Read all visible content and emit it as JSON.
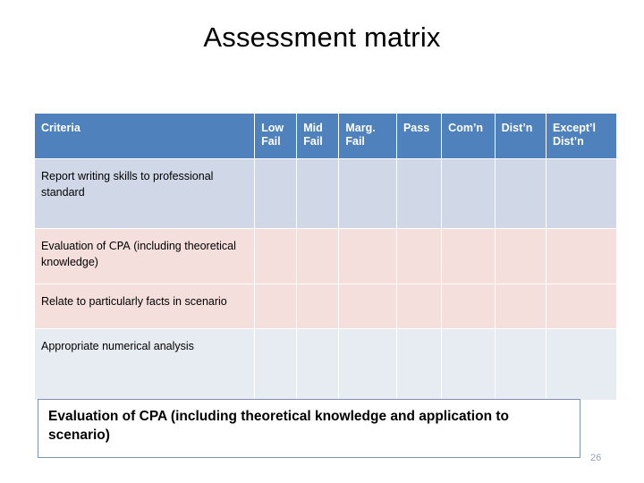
{
  "slide": {
    "title": "Assessment matrix",
    "page_number": "26",
    "colors": {
      "header_fill": "#4f81bd",
      "header_text": "#ffffff",
      "row_blue_fill": "#d0d8e8",
      "row_pink_fill": "#f4dfdc",
      "row_light_blue_fill": "#e7ecf3",
      "callout_border": "#7d93ab",
      "page_number_text": "#9aa5b1"
    }
  },
  "table": {
    "columns": [
      {
        "key": "criteria",
        "label": "Criteria"
      },
      {
        "key": "low_fail",
        "label": "Low Fail",
        "line1": "Low",
        "line2": "Fail"
      },
      {
        "key": "mid_fail",
        "label": "Mid Fail",
        "line1": "Mid",
        "line2": "Fail"
      },
      {
        "key": "marg_fail",
        "label": "Marg. Fail",
        "line1": "Marg.",
        "line2": "Fail"
      },
      {
        "key": "pass",
        "label": "Pass",
        "line1": "Pass",
        "line2": ""
      },
      {
        "key": "comn",
        "label": "Com’n",
        "line1": "Com’n",
        "line2": ""
      },
      {
        "key": "distn",
        "label": "Dist’n",
        "line1": "Dist’n",
        "line2": ""
      },
      {
        "key": "exceptl_distn",
        "label": "Except’l Dist’n",
        "line1": "Except’l",
        "line2": "Dist’n"
      }
    ],
    "rows": [
      {
        "criteria": "Report writing skills to professional standard",
        "style": "row-a",
        "cells": [
          "",
          "",
          "",
          "",
          "",
          "",
          ""
        ]
      },
      {
        "criteria_prefix": "Evaluation of ",
        "criteria_emphasis": "CPA",
        "criteria_suffix": "  (including theoretical knowledge)",
        "criteria": "Evaluation of CPA  (including theoretical knowledge)",
        "style": "row-b",
        "cells": [
          "",
          "",
          "",
          "",
          "",
          "",
          ""
        ]
      },
      {
        "criteria": "Relate to particularly facts in scenario",
        "style": "row-b",
        "cells": [
          "",
          "",
          "",
          "",
          "",
          "",
          ""
        ]
      },
      {
        "criteria": "Appropriate numerical analysis",
        "style": "row-c",
        "cells": [
          "",
          "",
          "",
          "",
          "",
          "",
          ""
        ]
      }
    ]
  },
  "callout": {
    "text": "Evaluation of CPA  (including theoretical knowledge and application to scenario)"
  }
}
